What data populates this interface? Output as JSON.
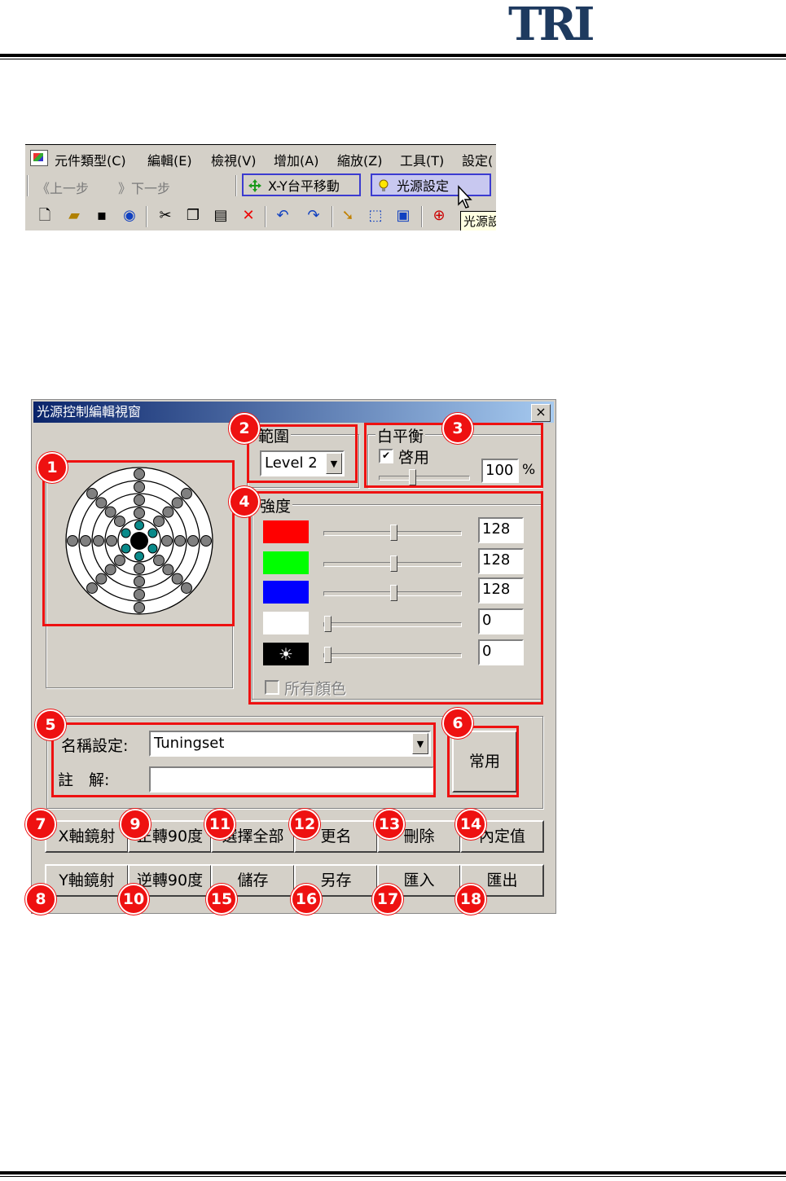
{
  "header": {
    "logo": "TRI"
  },
  "toolbar": {
    "menu": [
      "元件類型(C)",
      "編輯(E)",
      "檢視(V)",
      "增加(A)",
      "縮放(Z)",
      "工具(T)",
      "設定("
    ],
    "prev_label": "《上一步",
    "next_label": "》下一步",
    "xy_button": "X-Y台平移動",
    "light_button": "光源設定",
    "tooltip": "光源設"
  },
  "dialog": {
    "title": "光源控制編輯視窗",
    "close": "×",
    "range_label": "範圍",
    "range_value": "Level 2",
    "wb_label": "白平衡",
    "wb_enable": "啓用",
    "wb_value": "100",
    "wb_unit": "%",
    "intensity_label": "強度",
    "channels": [
      {
        "color": "#ff0000",
        "value": "128",
        "level": 0.5
      },
      {
        "color": "#00ff00",
        "value": "128",
        "level": 0.5
      },
      {
        "color": "#0000ff",
        "value": "128",
        "level": 0.5
      },
      {
        "color": "#ffffff",
        "value": "0",
        "level": 0.0
      },
      {
        "color": "#000000",
        "value": "0",
        "level": 0.0,
        "icon": "sun-icon"
      }
    ],
    "all_colors": "所有顏色",
    "name_label": "名稱設定:",
    "name_value": "Tuningset",
    "note_label": "註　解:",
    "note_value": "",
    "common_button": "常用",
    "buttons_row1": [
      "X軸鏡射",
      "正轉90度",
      "選擇全部",
      "更名",
      "刪除",
      "內定值"
    ],
    "buttons_row2": [
      "Y軸鏡射",
      "逆轉90度",
      "儲存",
      "另存",
      "匯入",
      "匯出"
    ]
  },
  "callouts": [
    "1",
    "2",
    "3",
    "4",
    "5",
    "6",
    "7",
    "8",
    "9",
    "10",
    "11",
    "12",
    "13",
    "14",
    "15",
    "16",
    "17",
    "18"
  ]
}
